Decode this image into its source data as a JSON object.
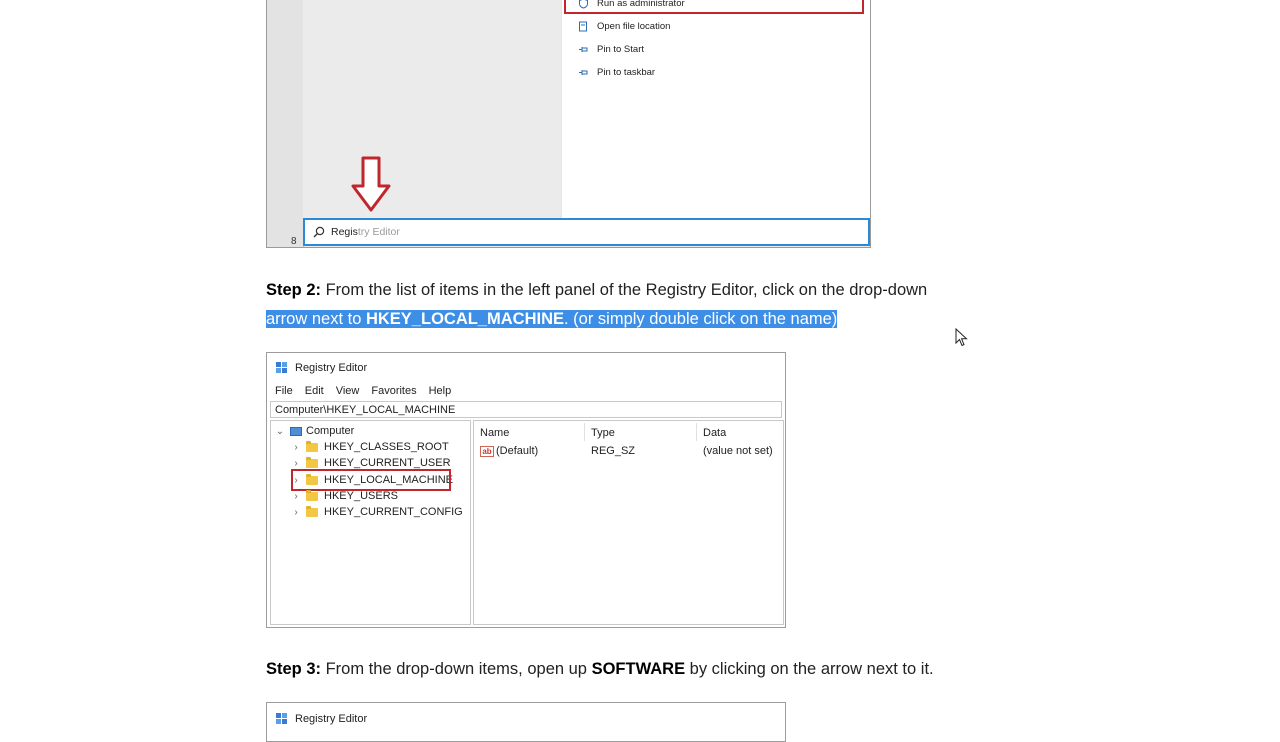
{
  "screenshot1": {
    "context_menu": {
      "items": [
        {
          "label": "Run as administrator",
          "icon": "shield-icon"
        },
        {
          "label": "Open file location",
          "icon": "folder-icon"
        },
        {
          "label": "Pin to Start",
          "icon": "pin-icon"
        },
        {
          "label": "Pin to taskbar",
          "icon": "pin-icon"
        }
      ]
    },
    "search": {
      "typed": "Regis",
      "suggestion": "try Editor"
    },
    "strip_text": "8"
  },
  "step2": {
    "label": "Step 2:",
    "text_a": " From the list of items in the left panel of the Registry Editor, click on the drop-down",
    "text_b": "arrow next to ",
    "bold": "HKEY_LOCAL_MACHINE",
    "text_c": ". (or simply double click on the name)"
  },
  "registry1": {
    "title": "Registry Editor",
    "menu": [
      "File",
      "Edit",
      "View",
      "Favorites",
      "Help"
    ],
    "address": "Computer\\HKEY_LOCAL_MACHINE",
    "tree": {
      "root": "Computer",
      "keys": [
        "HKEY_CLASSES_ROOT",
        "HKEY_CURRENT_USER",
        "HKEY_LOCAL_MACHINE",
        "HKEY_USERS",
        "HKEY_CURRENT_CONFIG"
      ]
    },
    "columns": [
      "Name",
      "Type",
      "Data"
    ],
    "rows": [
      {
        "name": "(Default)",
        "type": "REG_SZ",
        "data": "(value not set)"
      }
    ]
  },
  "step3": {
    "label": "Step 3:",
    "text_a": " From the drop-down items, open up ",
    "bold": "SOFTWARE",
    "text_b": " by clicking on the arrow next to it."
  },
  "registry2": {
    "title": "Registry Editor"
  },
  "colors": {
    "highlight_red": "#c0272d",
    "selection_blue": "#3d8ee6",
    "search_border": "#2b8ad6"
  }
}
